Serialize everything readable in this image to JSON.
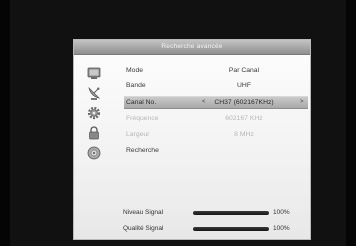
{
  "window": {
    "title": "Recherche avancée"
  },
  "settings": [
    {
      "label": "Mode",
      "value": "Par Canal",
      "state": "normal"
    },
    {
      "label": "Bande",
      "value": "UHF",
      "state": "normal"
    },
    {
      "label": "Canal No.",
      "value": "CH37 (602167KHz)",
      "state": "selected"
    },
    {
      "label": "Fréquence",
      "value": "602167 KHz",
      "state": "disabled"
    },
    {
      "label": "Largeur",
      "value": "8 MHz",
      "state": "disabled"
    },
    {
      "label": "Recherche",
      "value": "",
      "state": "normal"
    }
  ],
  "selector": {
    "left_arrow": "<",
    "right_arrow": ">"
  },
  "menu_icons": [
    "tv-icon",
    "satellite-dish-icon",
    "gear-icon",
    "lock-icon",
    "disc-icon"
  ],
  "signal": {
    "level_label": "Niveau Signal",
    "level_percent_text": "100%",
    "level_fraction": 1.0,
    "quality_label": "Qualité Signal",
    "quality_percent_text": "100%",
    "quality_fraction": 1.0
  }
}
